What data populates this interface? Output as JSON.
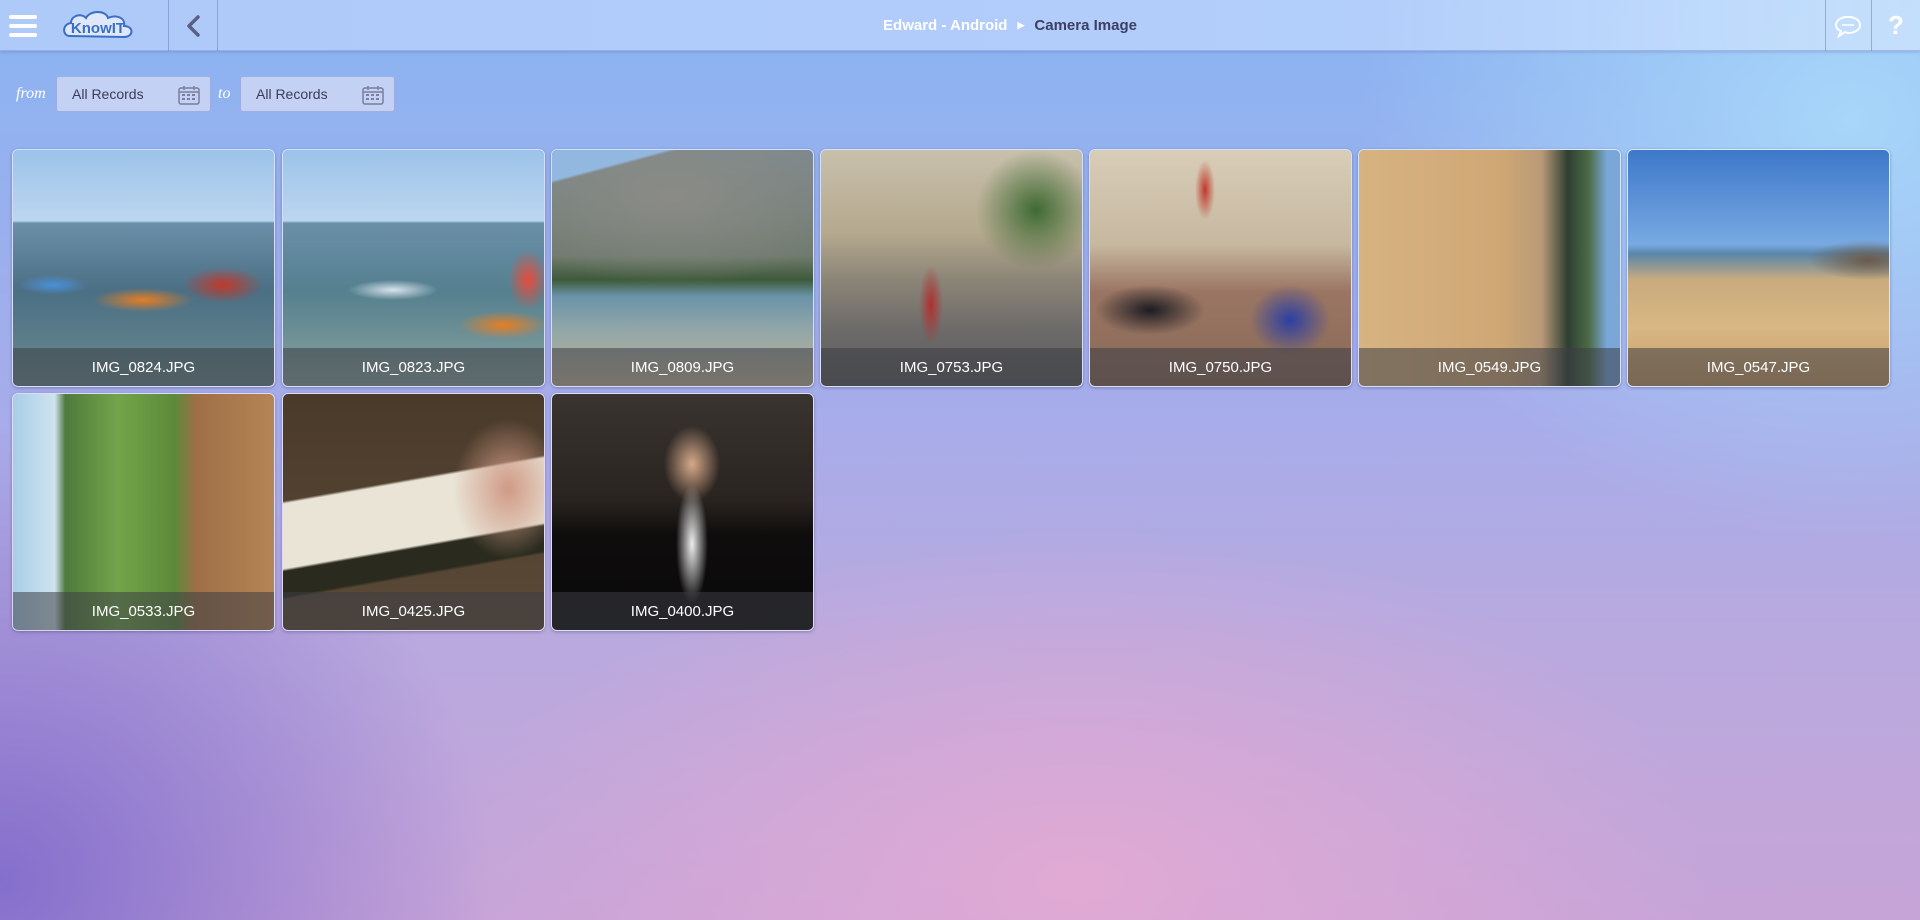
{
  "header": {
    "logo_text": "KnowIT",
    "breadcrumb": [
      "Edward - Android",
      "Camera Image"
    ],
    "help_label": "?"
  },
  "filters": {
    "from_label": "from",
    "to_label": "to",
    "from_value": "All Records",
    "to_value": "All Records"
  },
  "images": [
    {
      "name": "IMG_0824.JPG",
      "scene": "kayaks-sea"
    },
    {
      "name": "IMG_0823.JPG",
      "scene": "kayaks-sea-2"
    },
    {
      "name": "IMG_0809.JPG",
      "scene": "cliff-beach"
    },
    {
      "name": "IMG_0753.JPG",
      "scene": "casino-square"
    },
    {
      "name": "IMG_0750.JPG",
      "scene": "race-cars-showroom"
    },
    {
      "name": "IMG_0549.JPG",
      "scene": "sand-footprints"
    },
    {
      "name": "IMG_0547.JPG",
      "scene": "beach-shore"
    },
    {
      "name": "IMG_0533.JPG",
      "scene": "golf-course-rotated"
    },
    {
      "name": "IMG_0425.JPG",
      "scene": "wine-bottle-hand"
    },
    {
      "name": "IMG_0400.JPG",
      "scene": "man-in-tuxedo"
    }
  ],
  "colors": {
    "caption_bg": "#3c3e46",
    "header_text_light": "#ffffff",
    "header_text_dark": "#3d3f66",
    "logo_blue": "#3a6fc4"
  }
}
